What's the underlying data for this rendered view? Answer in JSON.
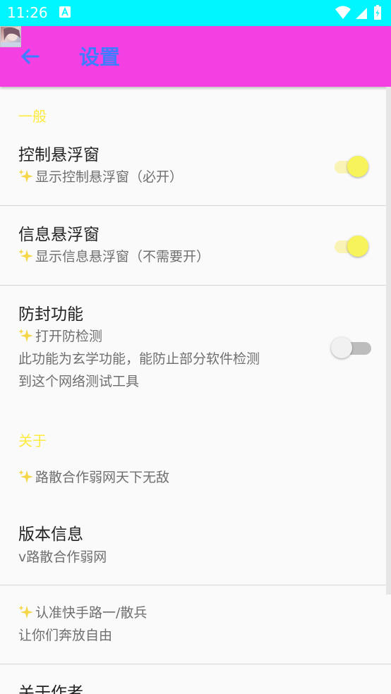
{
  "status_bar": {
    "time": "11:26"
  },
  "app_bar": {
    "title": "设置"
  },
  "sections": {
    "general": {
      "header": "一般"
    },
    "about": {
      "header": "关于"
    }
  },
  "items": {
    "control_float": {
      "title": "控制悬浮窗",
      "subtitle": "显示控制悬浮窗（必开）",
      "enabled": true
    },
    "info_float": {
      "title": "信息悬浮窗",
      "subtitle": "显示信息悬浮窗（不需要开）",
      "enabled": true
    },
    "anti_ban": {
      "title": "防封功能",
      "subtitle": "打开防检测",
      "desc_line1": "此功能为玄学功能，能防止部分软件检测",
      "desc_line2": "到这个网络测试工具",
      "enabled": false
    },
    "motto": {
      "text": "路散合作弱网天下无敌"
    },
    "version": {
      "title": "版本信息",
      "subtitle": "v路散合作弱网"
    },
    "recognize": {
      "line1": "认准快手路一/散兵",
      "line2": "让你们奔放自由"
    },
    "about_author": {
      "title": "关于作者"
    }
  },
  "colors": {
    "status_bar": "#00f6ff",
    "app_bar": "#f43fe2",
    "title": "#3f7cff",
    "section_header": "#ffeb3b",
    "switch_on": "#f7f35a"
  }
}
